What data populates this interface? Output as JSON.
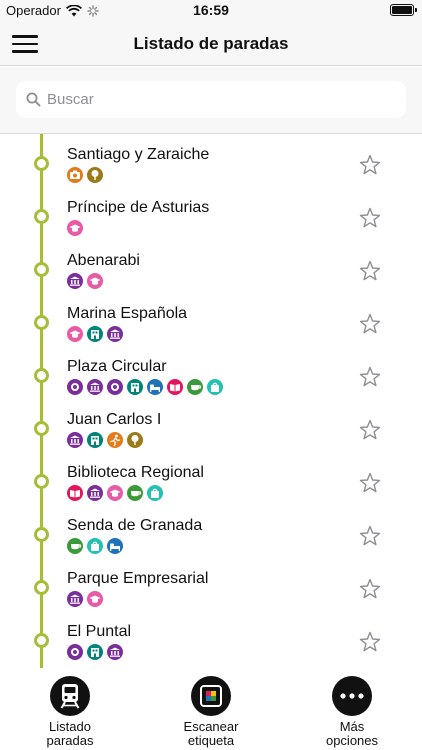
{
  "status": {
    "carrier": "Operador",
    "time": "16:59"
  },
  "header": {
    "title": "Listado de paradas"
  },
  "search": {
    "placeholder": "Buscar",
    "value": ""
  },
  "colors": {
    "route_line": "#a8bd37",
    "museum": "#7a2e9a",
    "education": "#e85aa6",
    "culture": "#00857a",
    "sports": "#e07d1a",
    "photo": "#e07d1a",
    "park": "#9a7a1a",
    "shopping": "#25c0b4",
    "restaurant": "#3a9a3a",
    "hotel": "#1f73b7",
    "library": "#e2165e"
  },
  "stops": [
    {
      "name": "Santiago y Zaraiche",
      "icons": [
        "camera-icon",
        "park-icon"
      ]
    },
    {
      "name": "Príncipe de Asturias",
      "icons": [
        "education-icon"
      ]
    },
    {
      "name": "Abenarabi",
      "icons": [
        "museum-icon",
        "education-icon"
      ]
    },
    {
      "name": "Marina Española",
      "icons": [
        "education-icon",
        "culture-icon",
        "museum-icon"
      ]
    },
    {
      "name": "Plaza Circular",
      "icons": [
        "ring-icon",
        "museum-icon",
        "ring-icon",
        "culture-icon",
        "hotel-icon",
        "library-icon",
        "restaurant-icon",
        "shopping-icon"
      ]
    },
    {
      "name": "Juan Carlos I",
      "icons": [
        "museum-icon",
        "culture-icon",
        "sports-icon",
        "park-icon"
      ]
    },
    {
      "name": "Biblioteca Regional",
      "icons": [
        "library-icon",
        "museum-icon",
        "education-icon",
        "restaurant-icon",
        "shopping-icon"
      ]
    },
    {
      "name": "Senda de Granada",
      "icons": [
        "restaurant-icon",
        "shopping-icon",
        "hotel-icon"
      ]
    },
    {
      "name": "Parque Empresarial",
      "icons": [
        "museum-icon",
        "education-icon"
      ]
    },
    {
      "name": "El Puntal",
      "icons": [
        "ring-icon",
        "culture-icon",
        "museum-icon"
      ]
    }
  ],
  "tabbar": {
    "items": [
      {
        "label": "Listado\nparadas",
        "icon": "train-icon"
      },
      {
        "label": "Escanear\netiqueta",
        "icon": "scan-icon"
      },
      {
        "label": "Más\nopciones",
        "icon": "more-icon"
      }
    ]
  }
}
